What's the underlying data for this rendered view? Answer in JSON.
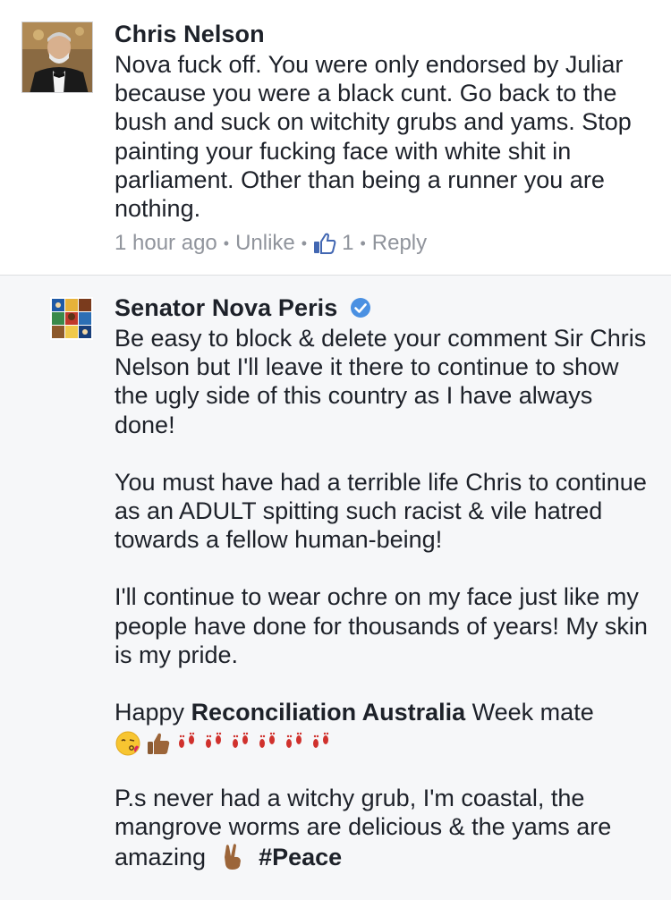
{
  "comments": [
    {
      "author": "Chris Nelson",
      "text": "Nova fuck off. You were only endorsed by Juliar because you were a black cunt. Go back to the bush and suck on witchity grubs and yams. Stop painting your fucking face with white shit in parliament. Other than being a runner you are nothing.",
      "time": "1 hour ago",
      "unlike_label": "Unlike",
      "like_count": "1",
      "reply_label": "Reply"
    },
    {
      "author": "Senator Nova Peris",
      "verified": true,
      "paragraphs": [
        "Be easy to block & delete your comment Sir Chris Nelson but I'll leave it there to continue to show the ugly side of this country as I have always done!",
        "You must have had a terrible life Chris to continue as an ADULT spitting such racist & vile hatred towards a fellow human-being!",
        "I'll continue to wear ochre on my face just like my people have done for thousands of years! My skin is my pride."
      ],
      "happy_prefix": "Happy",
      "happy_bold": "Reconciliation Australia",
      "happy_suffix": "Week mate",
      "emojis": [
        "kissing-face",
        "thumbs-up",
        "footprints",
        "footprints",
        "footprints",
        "footprints",
        "footprints",
        "footprints"
      ],
      "ps_text": "P.s never had a witchy grub, I'm coastal, the mangrove worms are delicious & the yams are amazing",
      "hashtag": "#Peace"
    }
  ],
  "colors": {
    "text": "#1d2129",
    "meta": "#90949c",
    "link": "#4267b2",
    "reply_bg": "#f6f7f9"
  }
}
